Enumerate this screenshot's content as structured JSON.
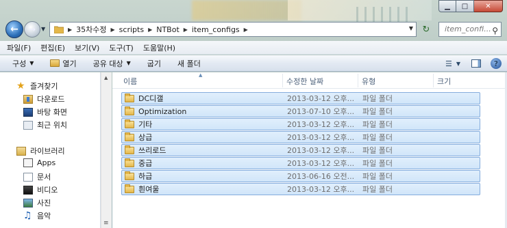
{
  "window": {
    "caption": {
      "minimize": "▁",
      "maximize": "□",
      "close": "✕"
    }
  },
  "nav": {
    "back_icon": "back-arrow-icon",
    "forward_icon": "forward-arrow-icon"
  },
  "address": {
    "crumbs": [
      "35차수정",
      "scripts",
      "NTBot",
      "item_configs"
    ]
  },
  "search": {
    "placeholder": "item_confi..."
  },
  "menu": {
    "items": [
      "파일(F)",
      "편집(E)",
      "보기(V)",
      "도구(T)",
      "도움말(H)"
    ]
  },
  "commands": {
    "organize": "구성",
    "open": "열기",
    "share": "공유 대상",
    "burn": "굽기",
    "new_folder": "새 폴더"
  },
  "sidebar": {
    "favorites": "즐겨찾기",
    "downloads": "다운로드",
    "desktop": "바탕 화면",
    "recent": "최근 위치",
    "libraries": "라이브러리",
    "apps": "Apps",
    "documents": "문서",
    "videos": "비디오",
    "pictures": "사진",
    "music": "음악"
  },
  "columns": {
    "name": "이름",
    "modified": "수정한 날짜",
    "type": "유형",
    "size": "크기"
  },
  "files": [
    {
      "name": "DC디갤",
      "date": "2013-03-12 오후...",
      "type": "파일 폴더"
    },
    {
      "name": "Optimization",
      "date": "2013-07-10 오후...",
      "type": "파일 폴더"
    },
    {
      "name": "기타",
      "date": "2013-03-12 오후...",
      "type": "파일 폴더"
    },
    {
      "name": "상급",
      "date": "2013-03-12 오후...",
      "type": "파일 폴더"
    },
    {
      "name": "쓰리로드",
      "date": "2013-03-12 오후...",
      "type": "파일 폴더"
    },
    {
      "name": "중급",
      "date": "2013-03-12 오후...",
      "type": "파일 폴더"
    },
    {
      "name": "하급",
      "date": "2013-06-16 오전...",
      "type": "파일 폴더"
    },
    {
      "name": "흰여울",
      "date": "2013-03-12 오후...",
      "type": "파일 폴더"
    }
  ],
  "colors": {
    "selection_fill": "#d9eafb",
    "selection_border": "#84acdd",
    "folder": "#e4b74a"
  }
}
